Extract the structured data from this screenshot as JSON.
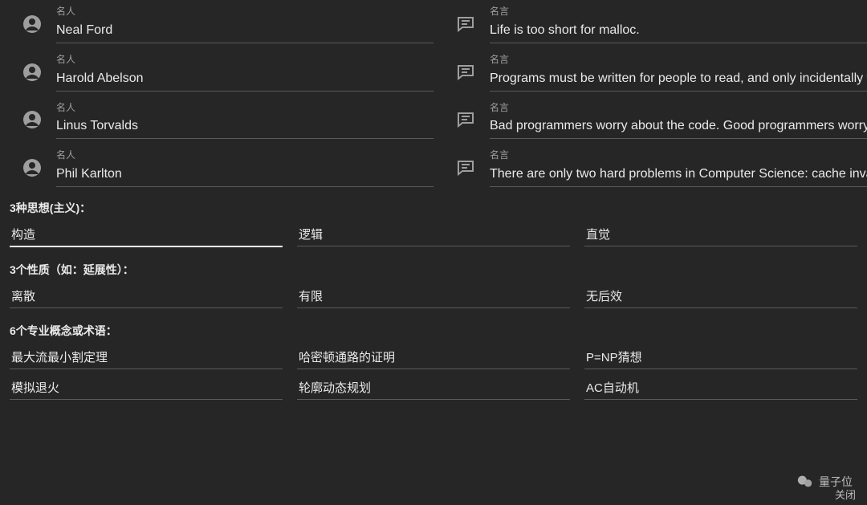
{
  "labels": {
    "person": "名人",
    "quote": "名言"
  },
  "quotes": [
    {
      "person": "Neal Ford",
      "text": "Life is too short for malloc."
    },
    {
      "person": "Harold Abelson",
      "text": "Programs must be written for people to read, and only incidentally fo"
    },
    {
      "person": "Linus Torvalds",
      "text": "Bad programmers worry about the code. Good programmers worry a"
    },
    {
      "person": "Phil Karlton",
      "text": "There are only two hard problems in Computer Science: cache invali"
    }
  ],
  "sections": {
    "s1_heading": "3种思想(主义)：",
    "s1": [
      "构造",
      "逻辑",
      "直觉"
    ],
    "s2_heading": "3个性质（如：延展性）：",
    "s2": [
      "离散",
      "有限",
      "无后效"
    ],
    "s3_heading": "6个专业概念或术语：",
    "s3a": [
      "最大流最小割定理",
      "哈密顿通路的证明",
      "P=NP猜想"
    ],
    "s3b": [
      "模拟退火",
      "轮廓动态规划",
      "AC自动机"
    ]
  },
  "watermark": "量子位",
  "close": "关闭"
}
